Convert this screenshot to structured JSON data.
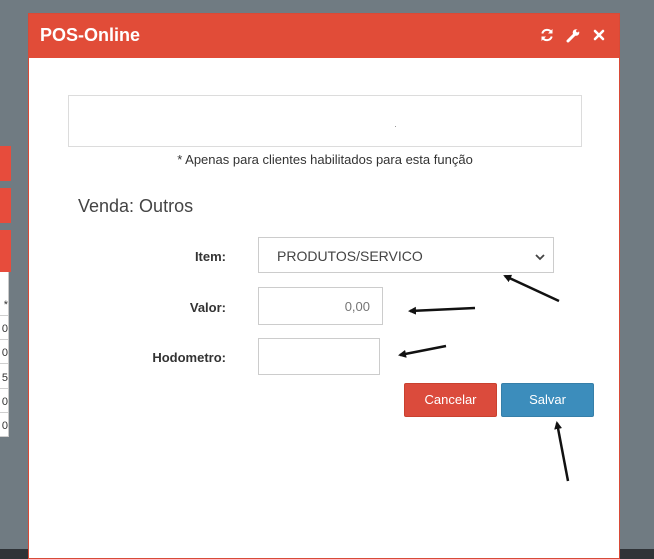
{
  "background": {
    "table_cells": [
      "*",
      "0",
      "0",
      "5",
      "0",
      "0"
    ]
  },
  "modal": {
    "title": "POS-Online",
    "header_icons": [
      "refresh-icon",
      "wrench-icon",
      "close-icon"
    ],
    "notice": "* Apenas para clientes habilitados para esta função",
    "section_title": "Venda: Outros",
    "item": {
      "label": "Item:",
      "selected": "PRODUTOS/SERVICO"
    },
    "valor": {
      "label": "Valor:",
      "placeholder": "0,00",
      "value": ""
    },
    "hodometro": {
      "label": "Hodometro:",
      "value": ""
    },
    "buttons": {
      "cancel": "Cancelar",
      "save": "Salvar"
    }
  },
  "colors": {
    "header": "#e14c38",
    "cancel": "#db4b3c",
    "save": "#3c8dbc",
    "backdrop": "#707b82"
  }
}
